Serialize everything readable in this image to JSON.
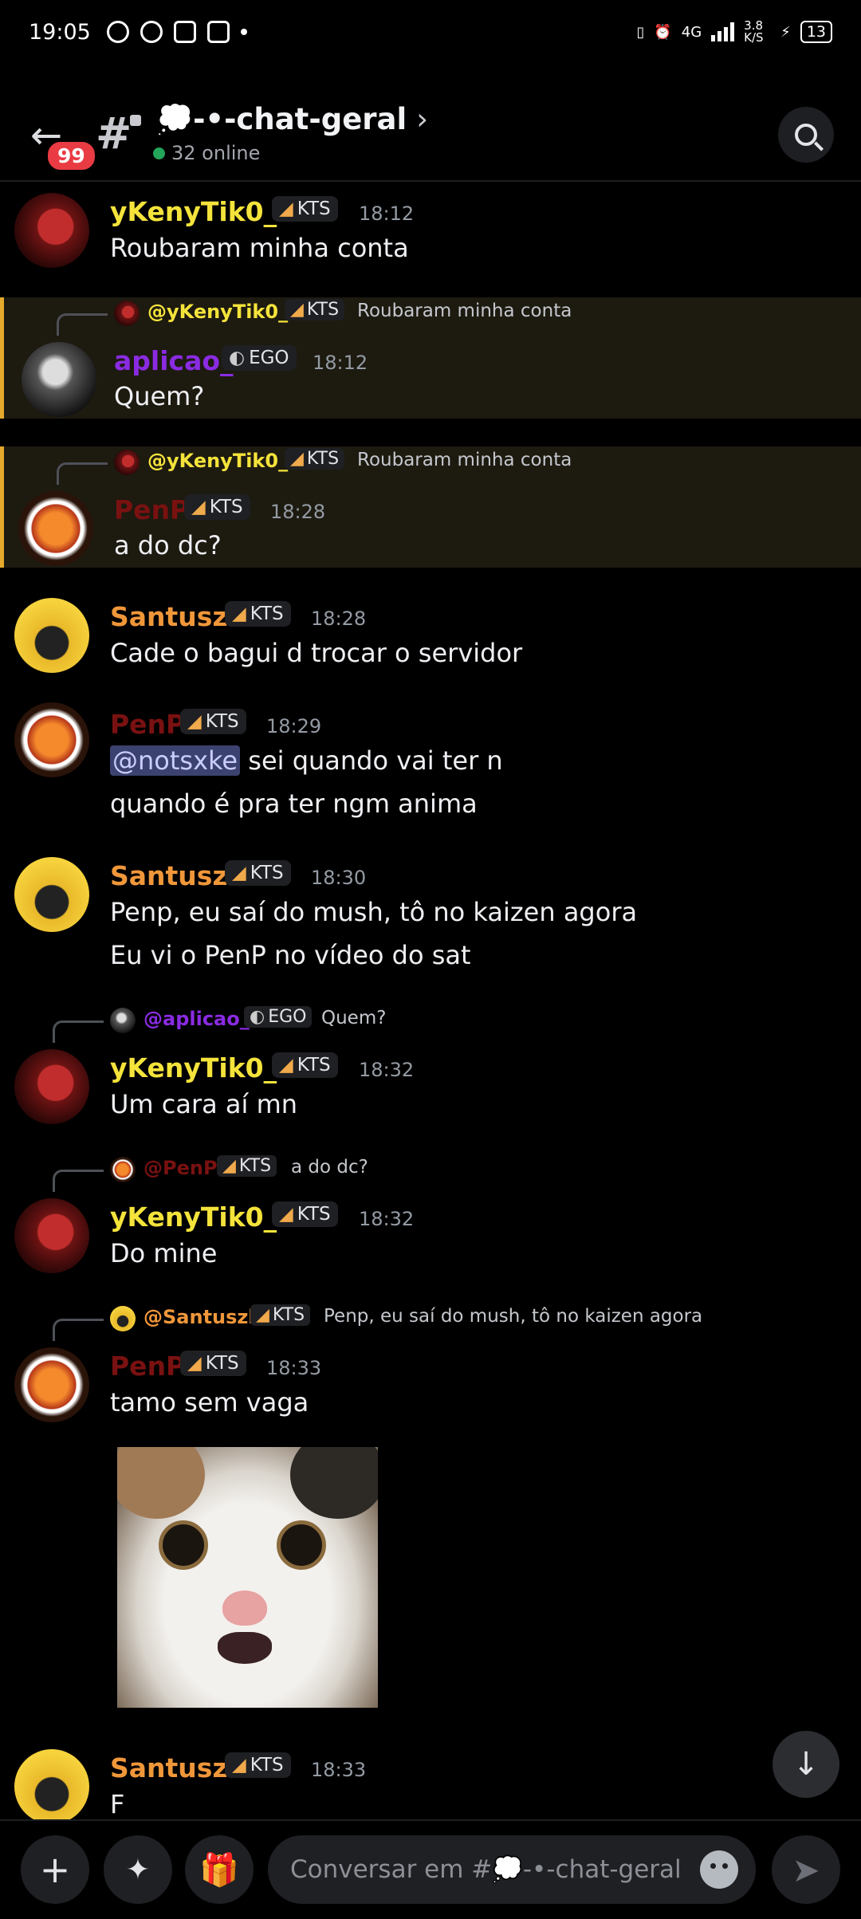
{
  "status_bar": {
    "time": "19:05",
    "network": "4G",
    "speed": "3.8 K/S",
    "battery": "13"
  },
  "header": {
    "back_badge": "99",
    "channel_name": "💭-•-chat-geral",
    "online": "32 online"
  },
  "messages": [
    {
      "user": "yKenyTik0_0",
      "tag": "KTS",
      "time": "18:12",
      "lines": [
        "Roubaram minha conta"
      ]
    },
    {
      "reply": {
        "user": "@yKenyTik0_0",
        "tag": "KTS",
        "text": "Roubaram minha conta"
      },
      "user": "aplicao_",
      "tag": "EGO",
      "time": "18:12",
      "lines": [
        "Quem?"
      ]
    },
    {
      "reply": {
        "user": "@yKenyTik0_0",
        "tag": "KTS",
        "text": "Roubaram minha conta"
      },
      "user": "PenP",
      "tag": "KTS",
      "time": "18:28",
      "lines": [
        "a do dc?"
      ]
    },
    {
      "user": "Santuszk",
      "tag": "KTS",
      "time": "18:28",
      "lines": [
        "Cade o bagui d trocar o servidor"
      ]
    },
    {
      "user": "PenP",
      "tag": "KTS",
      "time": "18:29",
      "mention": "@notsxke",
      "lines": [
        " sei quando vai ter n",
        "quando é pra ter ngm anima"
      ]
    },
    {
      "user": "Santuszk",
      "tag": "KTS",
      "time": "18:30",
      "lines": [
        "Penp, eu saí do mush, tô no kaizen agora",
        "Eu vi o PenP no vídeo do sat"
      ]
    },
    {
      "reply": {
        "user": "@aplicao_",
        "tag": "EGO",
        "text": "Quem?"
      },
      "user": "yKenyTik0_0",
      "tag": "KTS",
      "time": "18:32",
      "lines": [
        "Um cara aí mn"
      ]
    },
    {
      "reply": {
        "user": "@PenP",
        "tag": "KTS",
        "text": "a do dc?"
      },
      "user": "yKenyTik0_0",
      "tag": "KTS",
      "time": "18:32",
      "lines": [
        "Do mine"
      ]
    },
    {
      "reply": {
        "user": "@Santuszk",
        "tag": "KTS",
        "text": "Penp, eu saí do mush, tô no kaizen agora"
      },
      "user": "PenP",
      "tag": "KTS",
      "time": "18:33",
      "lines": [
        "tamo sem vaga"
      ]
    },
    {
      "user": "Santuszk",
      "tag": "KTS",
      "time": "18:33",
      "lines": [
        "F"
      ]
    }
  ],
  "composer": {
    "placeholder": "Conversar em #💭-•-chat-geral"
  },
  "colors": {
    "yKenyTik0_0": "#f4e33b",
    "aplicao_": "#8a2be2",
    "PenP": "#7a1111",
    "Santuszk": "#f0973a",
    "highlight_border": "#e5a92b",
    "online_dot": "#23a55a"
  },
  "icons": [
    "back-arrow-icon",
    "channel-hash-icon",
    "search-icon",
    "scroll-down-icon",
    "plus-icon",
    "apps-icon",
    "gift-icon",
    "emoji-icon",
    "send-icon"
  ]
}
